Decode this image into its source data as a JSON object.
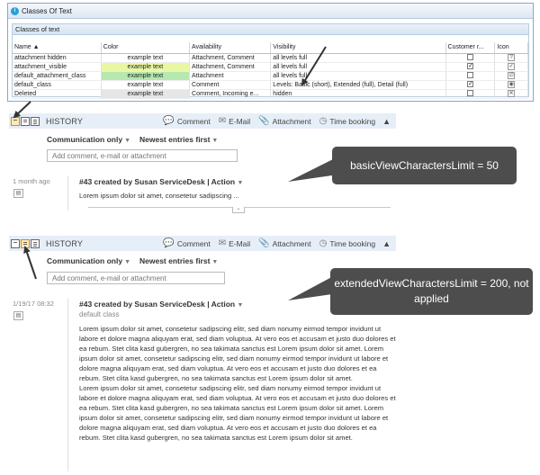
{
  "window": {
    "title": "Classes Of Text",
    "panel_title": "Classes of text"
  },
  "table": {
    "columns": [
      "Name ▲",
      "Color",
      "Availability",
      "Visibility",
      "Customer r...",
      "Icon"
    ],
    "rows": [
      {
        "name": "attachment hidden",
        "color_text": "example text",
        "color_bg": "#ffffff",
        "availability": "Attachment, Comment",
        "visibility": "all levels full",
        "customer": false,
        "icon": "?"
      },
      {
        "name": "attachment_visible",
        "color_text": "example text",
        "color_bg": "#e9f7a3",
        "availability": "Attachment, Comment",
        "visibility": "all levels full",
        "customer": true,
        "icon": "✓"
      },
      {
        "name": "default_attachment_class",
        "color_text": "example text",
        "color_bg": "#b6e8b0",
        "availability": "Attachment",
        "visibility": "all levels full",
        "customer": false,
        "icon": "∅"
      },
      {
        "name": "default_class",
        "color_text": "example text",
        "color_bg": "#ffffff",
        "availability": "Comment",
        "visibility": "Levels: Basic (short), Extended (full), Detail (full)",
        "customer": true,
        "icon": "◉"
      },
      {
        "name": "Deleted",
        "color_text": "example text",
        "color_bg": "#e6e6e6",
        "availability": "Comment, Incoming e...",
        "visibility": "hidden",
        "customer": false,
        "icon": "✕"
      }
    ]
  },
  "history": {
    "label": "HISTORY",
    "actions": {
      "comment": "Comment",
      "email": "E-Mail",
      "attachment": "Attachment",
      "time_booking": "Time booking"
    },
    "filter_communication": "Communication only",
    "filter_sort": "Newest entries first",
    "input_placeholder": "Add comment, e-mail or attachment"
  },
  "entry1": {
    "date": "1 month ago",
    "title": "#43 created by Susan ServiceDesk | Action",
    "preview": "Lorem ipsum dolor sit amet, consetetur sadipscing ..."
  },
  "entry2": {
    "date": "1/19/17 08:32",
    "title": "#43 created by Susan ServiceDesk | Action",
    "class": "default class",
    "paragraphs": [
      "Lorem ipsum dolor sit amet, consetetur sadipscing elitr, sed diam nonumy eirmod tempor invidunt ut labore et dolore magna aliquyam erat, sed diam voluptua. At vero eos et accusam et justo duo dolores et ea rebum. Stet clita kasd gubergren, no sea takimata sanctus est Lorem ipsum dolor sit amet. Lorem ipsum dolor sit amet, consetetur sadipscing elitr, sed diam nonumy eirmod tempor invidunt ut labore et dolore magna aliquyam erat, sed diam voluptua. At vero eos et accusam et justo duo dolores et ea rebum. Stet clita kasd gubergren, no sea takimata sanctus est Lorem ipsum dolor sit amet.",
      "Lorem ipsum dolor sit amet, consetetur sadipscing elitr, sed diam nonumy eirmod tempor invidunt ut labore et dolore magna aliquyam erat, sed diam voluptua. At vero eos et accusam et justo duo dolores et ea rebum. Stet clita kasd gubergren, no sea takimata sanctus est Lorem ipsum dolor sit amet. Lorem ipsum dolor sit amet, consetetur sadipscing elitr, sed diam nonumy eirmod tempor invidunt ut labore et dolore magna aliquyam erat, sed diam voluptua. At vero eos et accusam et justo duo dolores et ea rebum. Stet clita kasd gubergren, no sea takimata sanctus est Lorem ipsum dolor sit amet."
    ]
  },
  "callouts": {
    "basic": "basicViewCharactersLimit = 50",
    "extended": "extendedViewCharactersLimit = 200, not applied"
  },
  "colors": {
    "callout_bg": "#4d4d4d",
    "history_bar_bg": "#e6eef7",
    "active_toggle": "#e08a00"
  },
  "icons": {
    "app": "app-info-icon",
    "comment": "speech-bubble-icon",
    "email": "envelope-icon",
    "attachment": "paperclip-icon",
    "time": "clock-icon",
    "collapse": "chevron-up-icon"
  }
}
